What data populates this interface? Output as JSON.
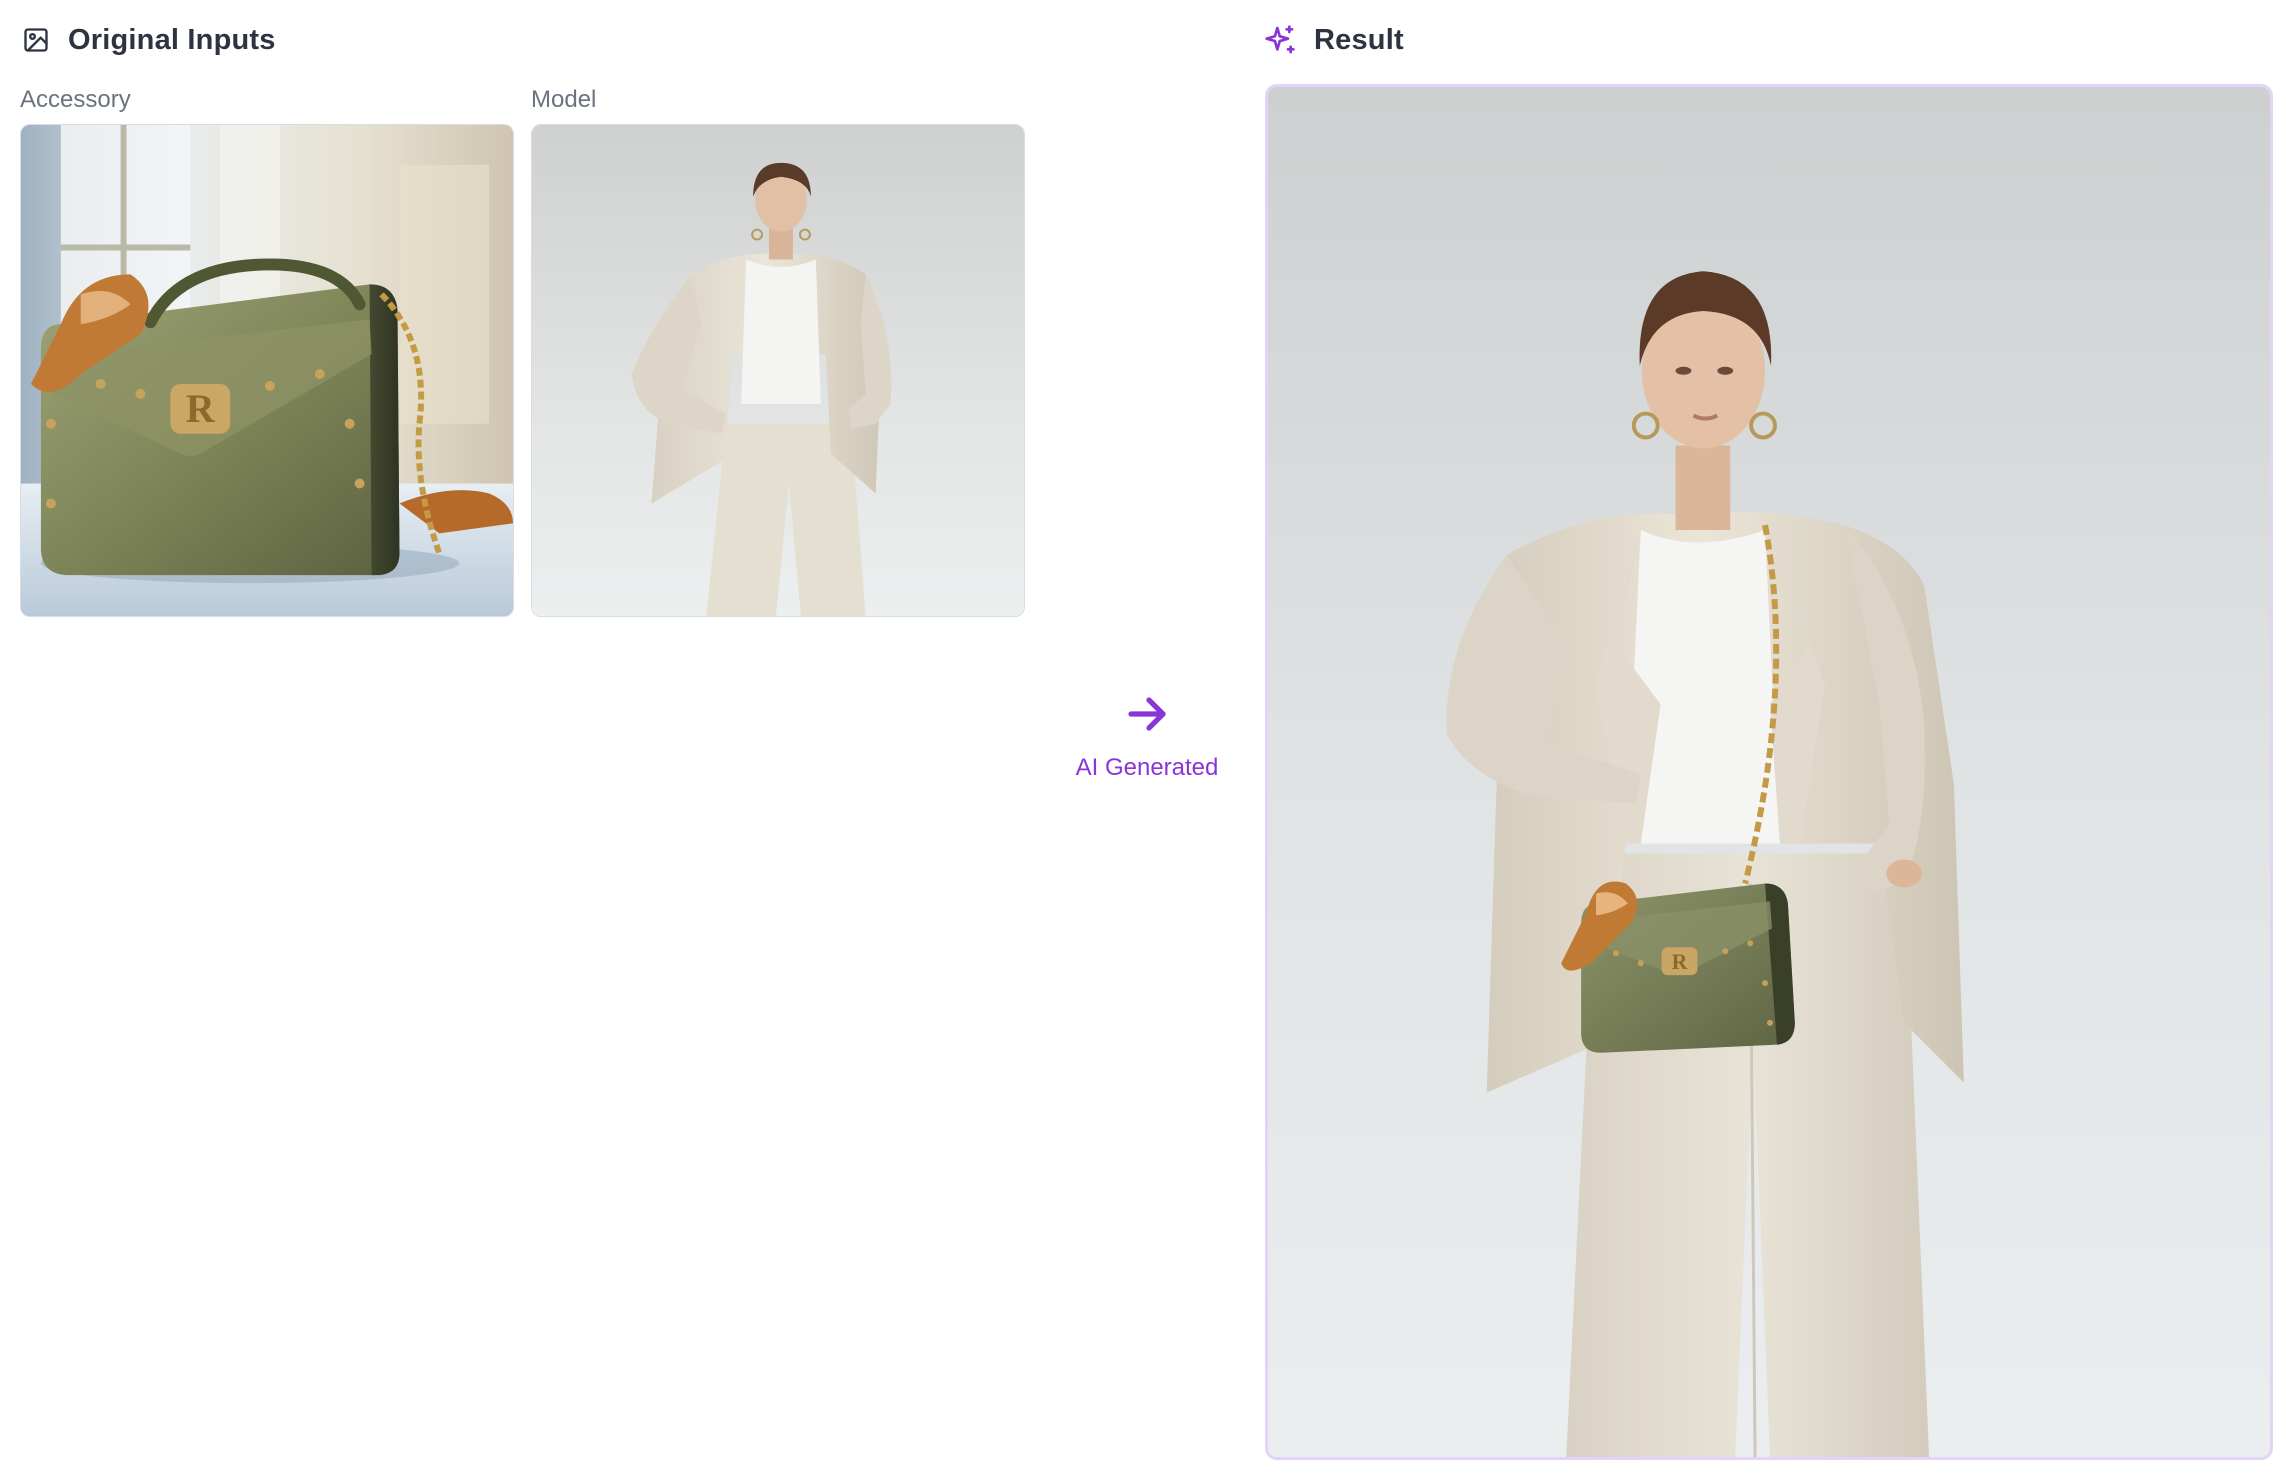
{
  "inputs": {
    "title": "Original Inputs",
    "icon": "image-icon",
    "accessory": {
      "label": "Accessory",
      "image": "green leather handbag with gold logo clasp, silk scarf and chain strap"
    },
    "model": {
      "label": "Model",
      "image": "woman in cream linen suit standing against light grey wall"
    }
  },
  "transition": {
    "icon": "arrow-right-icon",
    "label": "AI Generated"
  },
  "result": {
    "title": "Result",
    "icon": "sparkles-icon",
    "image": "model in cream suit wearing the green handbag on a chain strap"
  },
  "colors": {
    "accent": "#8a35d6",
    "title_text": "#2d3340",
    "label_text": "#6b7280",
    "result_border": "#e3d3f7"
  }
}
